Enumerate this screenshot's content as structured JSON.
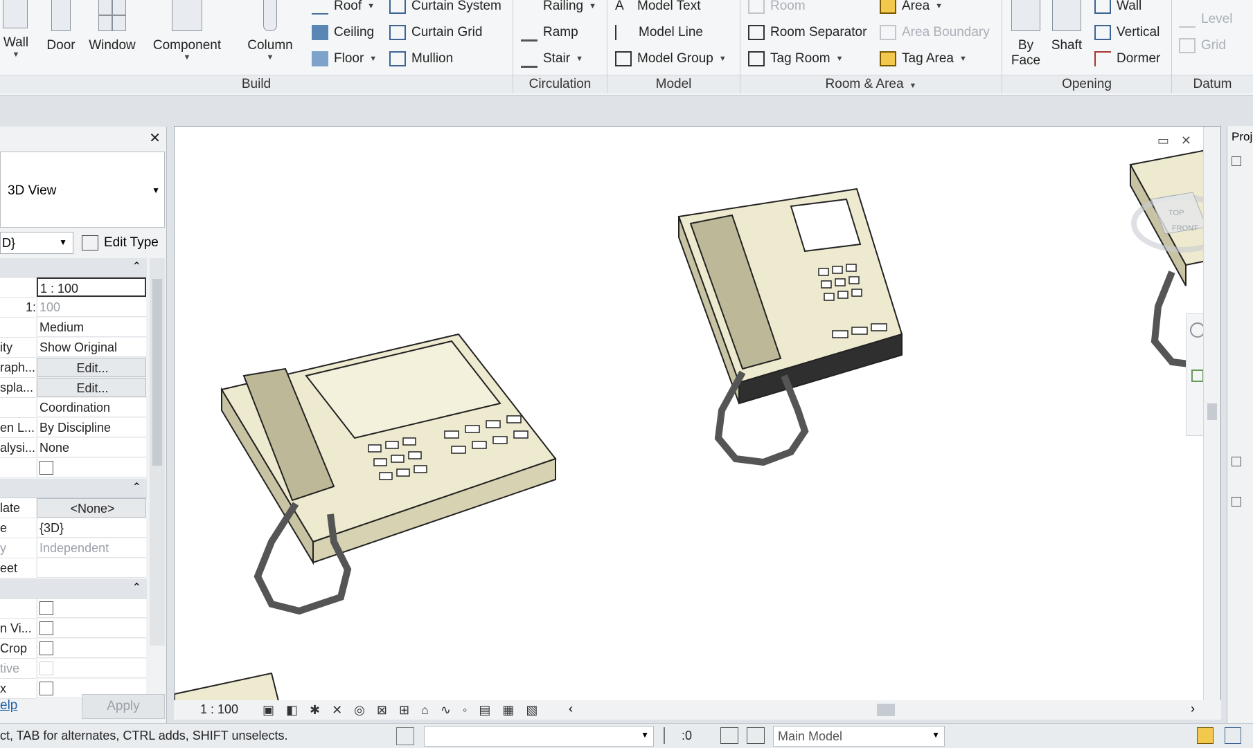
{
  "ribbon": {
    "build": {
      "title": "Build",
      "big": [
        {
          "label": "Wall",
          "icon": "wall-icon"
        },
        {
          "label": "Door",
          "icon": "door-icon"
        },
        {
          "label": "Window",
          "icon": "window-icon"
        },
        {
          "label": "Component",
          "icon": "component-icon"
        },
        {
          "label": "Column",
          "icon": "column-icon"
        }
      ],
      "col1": [
        "Roof",
        "Ceiling",
        "Floor"
      ],
      "col2": [
        "Curtain System",
        "Curtain Grid",
        "Mullion"
      ]
    },
    "circulation": {
      "title": "Circulation",
      "items": [
        "Railing",
        "Ramp",
        "Stair"
      ]
    },
    "model": {
      "title": "Model",
      "items": [
        "Model Text",
        "Model Line",
        "Model Group"
      ]
    },
    "room_area": {
      "title": "Room & Area",
      "col1": [
        "Room",
        "Room Separator",
        "Tag Room"
      ],
      "col2": [
        "Area",
        "Area Boundary",
        "Tag Area"
      ]
    },
    "opening": {
      "title": "Opening",
      "by_face": [
        "By",
        "Face"
      ],
      "shaft": "Shaft",
      "items": [
        "Wall",
        "Vertical",
        "Dormer"
      ]
    },
    "datum": {
      "title": "Datum",
      "items": [
        "Level",
        "Grid"
      ]
    }
  },
  "properties": {
    "type_selector": "3D View",
    "view_dropdown": "D}",
    "edit_type": "Edit Type",
    "rows": [
      {
        "label": "",
        "value": "1 : 100"
      },
      {
        "label": "1:",
        "value": "100"
      },
      {
        "label": "",
        "value": "Medium"
      },
      {
        "label": "ity",
        "value": "Show Original"
      },
      {
        "label": "raph...",
        "value": "Edit..."
      },
      {
        "label": "spla...",
        "value": "Edit..."
      },
      {
        "label": "",
        "value": "Coordination"
      },
      {
        "label": "en L...",
        "value": "By Discipline"
      },
      {
        "label": "alysi...",
        "value": "None"
      }
    ],
    "rows2": [
      {
        "label": "late",
        "value": "<None>"
      },
      {
        "label": "e",
        "value": "{3D}"
      },
      {
        "label": "y",
        "value": "Independent"
      },
      {
        "label": "eet",
        "value": ""
      }
    ],
    "rows3": [
      "",
      "n Vi...",
      " Crop",
      "tive",
      "x"
    ],
    "help": "elp",
    "apply": "Apply"
  },
  "view": {
    "scale": "1 : 100",
    "viewcube_top": "TOP",
    "viewcube_front": "FRONT"
  },
  "browser": {
    "title": "Proj"
  },
  "status": {
    "hint": "ct, TAB for alternates, CTRL adds, SHIFT unselects.",
    "sel_count": ":0",
    "workset": "Main Model"
  }
}
